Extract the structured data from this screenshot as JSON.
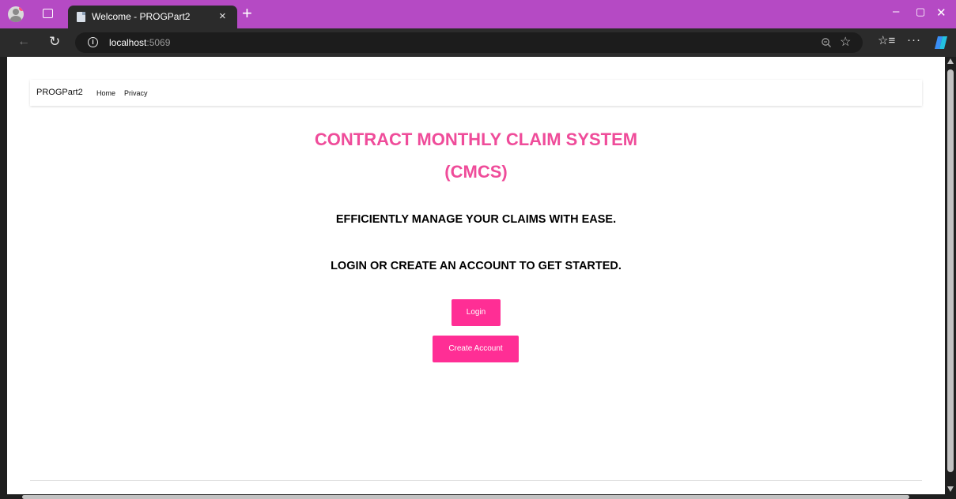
{
  "browser": {
    "tab_title": "Welcome - PROGPart2",
    "tab_close": "×",
    "new_tab": "+",
    "url_host": "localhost",
    "url_port": ":5069",
    "window_min": "–",
    "window_restore": "▢",
    "window_close": "✕",
    "icons": [
      "profile-avatar-icon",
      "tab-actions-icon",
      "page-favicon-icon",
      "back-icon",
      "reload-icon",
      "info-icon",
      "zoom-icon",
      "star-icon",
      "favorites-icon",
      "more-icon",
      "copilot-icon"
    ]
  },
  "navbar": {
    "brand": "PROGPart2",
    "links": [
      {
        "label": "Home"
      },
      {
        "label": "Privacy"
      }
    ]
  },
  "main": {
    "title_line1": "CONTRACT MONTHLY CLAIM SYSTEM",
    "title_line2": "(CMCS)",
    "tagline": "EFFICIENTLY MANAGE YOUR CLAIMS WITH EASE.",
    "prompt": "LOGIN OR CREATE AN ACCOUNT TO GET STARTED.",
    "login_label": "Login",
    "create_account_label": "Create Account"
  },
  "colors": {
    "titlebar": "#b54ac4",
    "heading_pink": "#ef4c9a",
    "button_pink": "#ff2e95"
  }
}
